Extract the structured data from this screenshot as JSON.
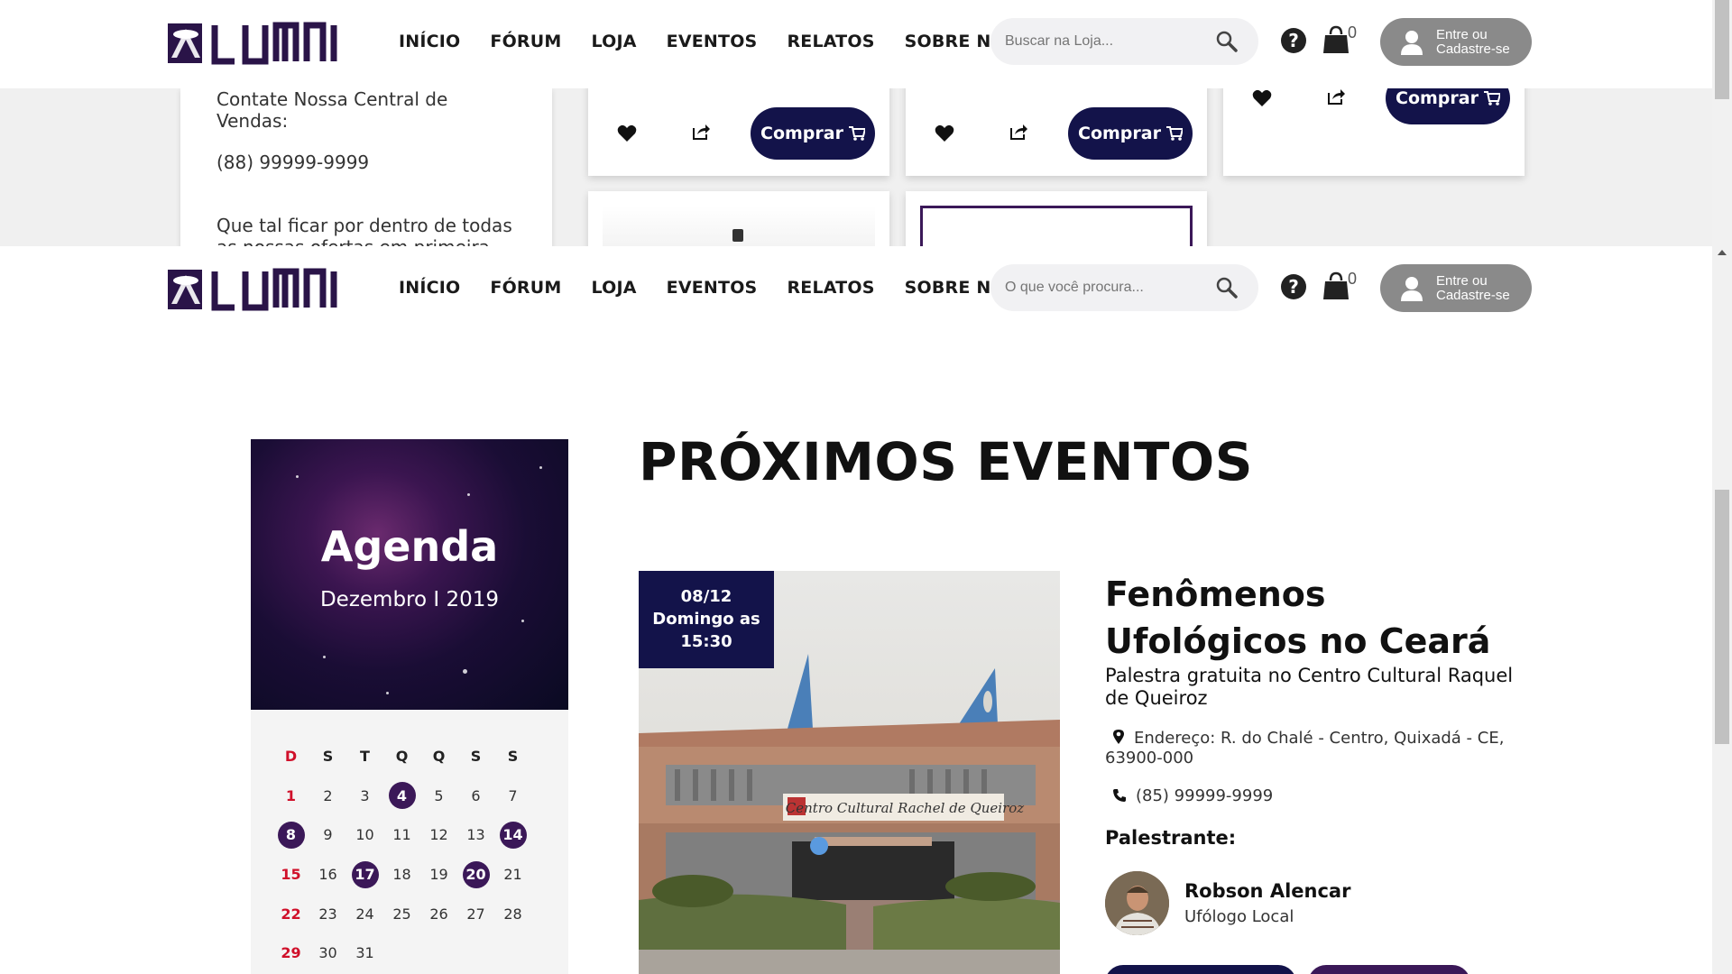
{
  "brand": {
    "name": "LUMNI",
    "accent": "#13134a",
    "purple": "#3b1858"
  },
  "nav": {
    "items": [
      "INÍCIO",
      "FÓRUM",
      "LOJA",
      "EVENTOS",
      "RELATOS",
      "SOBRE NÓS"
    ]
  },
  "header_top": {
    "search_placeholder": "Buscar na Loja..."
  },
  "header_main": {
    "search_placeholder": "O que você procura..."
  },
  "cart": {
    "count": "0"
  },
  "login": {
    "line1": "Entre ou",
    "line2": "Cadastre-se"
  },
  "contact": {
    "line1": "Contate Nossa Central de Vendas:",
    "phone": "(88) 99999-9999",
    "newsletter": "Que tal ficar por dentro de todas as nossas ofertas em primeira mão?"
  },
  "products": {
    "buy_label": "Comprar"
  },
  "agenda": {
    "title": "Agenda",
    "month": "Dezembro I 2019"
  },
  "calendar": {
    "weekdays": [
      "D",
      "S",
      "T",
      "Q",
      "Q",
      "S",
      "S"
    ],
    "days": [
      1,
      2,
      3,
      4,
      5,
      6,
      7,
      8,
      9,
      10,
      11,
      12,
      13,
      14,
      15,
      16,
      17,
      18,
      19,
      20,
      21,
      22,
      23,
      24,
      25,
      26,
      27,
      28,
      29,
      30,
      31
    ],
    "event_days": [
      4,
      8,
      14,
      17,
      20
    ]
  },
  "events": {
    "title": "PRÓXIMOS EVENTOS",
    "featured": {
      "date_line1": "08/12",
      "date_line2": "Domingo as",
      "date_line3": "15:30",
      "name": "Fenômenos Ufológicos no Ceará",
      "subtitle": "Palestra gratuita no Centro Cultural Raquel de Queiroz",
      "address": "Endereço: R. do Chalé - Centro, Quixadá - CE, 63900-000",
      "phone": "(85) 99999-9999",
      "speaker_label": "Palestrante:",
      "speaker_name": "Robson Alencar",
      "speaker_role": "Ufólogo Local",
      "building_sign": "Centro Cultural Rachel de Queiroz"
    }
  }
}
